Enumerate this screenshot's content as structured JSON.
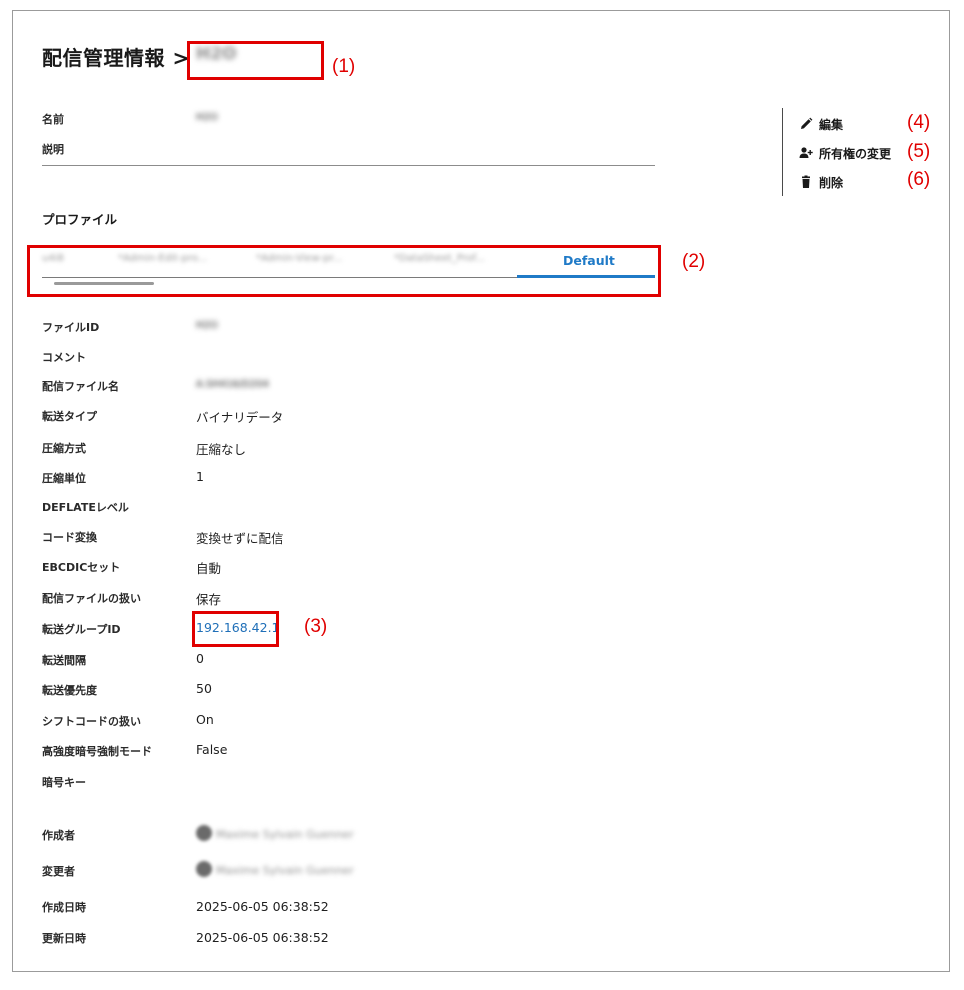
{
  "header": {
    "title": "配信管理情報 >",
    "name_blurred": "H2O"
  },
  "callouts": [
    "(1)",
    "(2)",
    "(3)",
    "(4)",
    "(5)",
    "(6)"
  ],
  "basic": {
    "name_label": "名前",
    "name_value": "H2O",
    "description_label": "説明"
  },
  "actions": {
    "edit": "編集",
    "change_owner": "所有権の変更",
    "delete": "削除"
  },
  "profile": {
    "section_title": "プロファイル",
    "tabs": [
      "u4i8",
      "*Admin-Edit-pro...",
      "*Admin-View-pr...",
      "*DataSheet_Prof...",
      "Default"
    ],
    "active_tab": "Default"
  },
  "details": [
    {
      "label": "ファイルID",
      "value": "H2O",
      "blurred": true
    },
    {
      "label": "コメント",
      "value": ""
    },
    {
      "label": "配信ファイル名",
      "value": "A.SH416/D204",
      "blurred": true
    },
    {
      "label": "転送タイプ",
      "value": "バイナリデータ"
    },
    {
      "label": "圧縮方式",
      "value": "圧縮なし"
    },
    {
      "label": "圧縮単位",
      "value": "1"
    },
    {
      "label": "DEFLATEレベル",
      "value": ""
    },
    {
      "label": "コード変換",
      "value": "変換せずに配信"
    },
    {
      "label": "EBCDICセット",
      "value": "自動"
    },
    {
      "label": "配信ファイルの扱い",
      "value": "保存"
    },
    {
      "label": "転送グループID",
      "value": "192.168.42.1",
      "link": true
    },
    {
      "label": "転送間隔",
      "value": "0"
    },
    {
      "label": "転送優先度",
      "value": "50"
    },
    {
      "label": "シフトコードの扱い",
      "value": "On"
    },
    {
      "label": "高強度暗号強制モード",
      "value": "False"
    },
    {
      "label": "暗号キー",
      "value": ""
    }
  ],
  "meta": {
    "creator_label": "作成者",
    "creator_value": "Maxime Sylvain Guenner",
    "modifier_label": "変更者",
    "modifier_value": "Maxime Sylvain Guenner",
    "created_label": "作成日時",
    "created_value": "2025-06-05 06:38:52",
    "updated_label": "更新日時",
    "updated_value": "2025-06-05 06:38:52"
  },
  "colors": {
    "accent": "#1f7ac7",
    "link": "#1f6fb8",
    "callout": "#e00000"
  }
}
